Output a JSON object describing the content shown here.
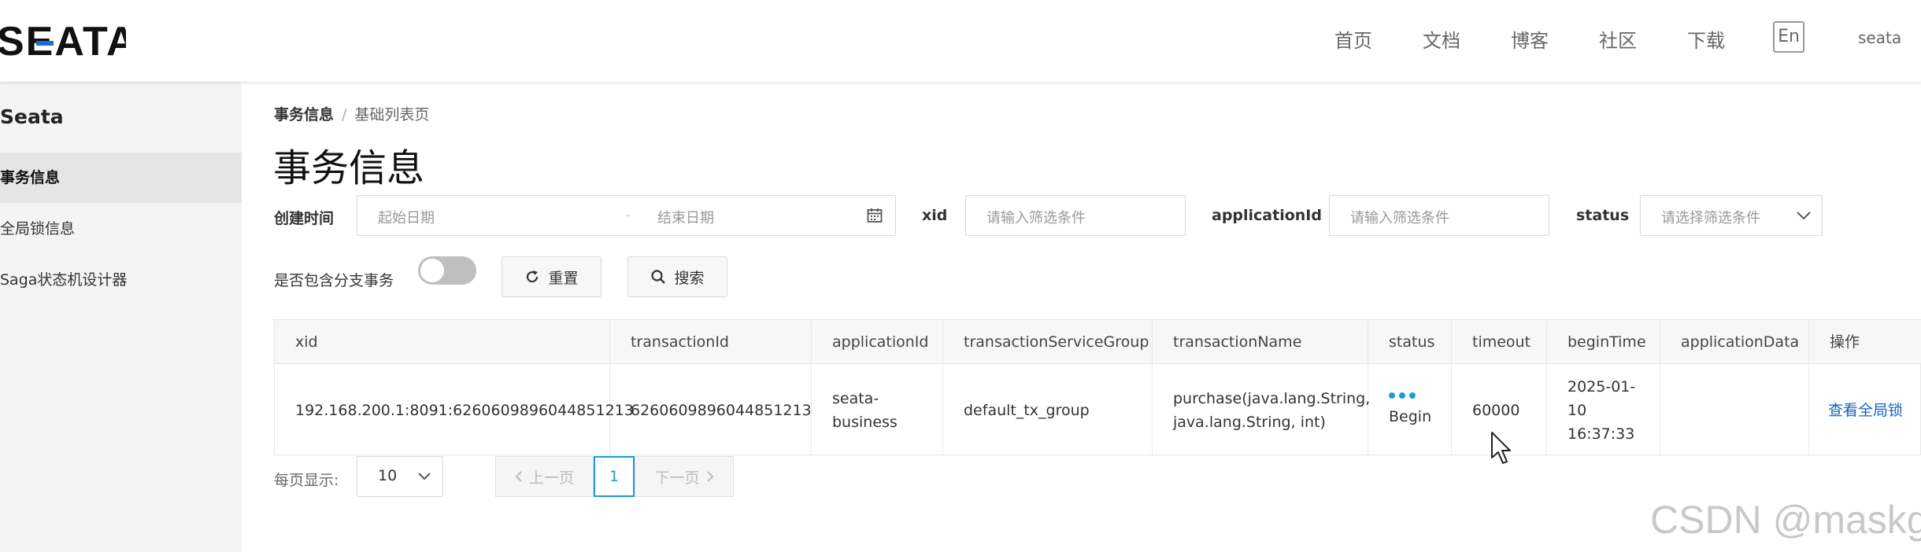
{
  "header": {
    "logo_text": "SEATA",
    "nav": [
      "首页",
      "文档",
      "博客",
      "社区",
      "下载"
    ],
    "lang": "En",
    "user": "seata"
  },
  "sidebar": {
    "title": "Seata",
    "items": [
      {
        "label": "事务信息",
        "active": true
      },
      {
        "label": "全局锁信息",
        "active": false
      },
      {
        "label": "Saga状态机设计器",
        "active": false
      }
    ]
  },
  "breadcrumb": {
    "first": "事务信息",
    "sep": "/",
    "second": "基础列表页"
  },
  "page_title": "事务信息",
  "filters": {
    "create_time_label": "创建时间",
    "start_placeholder": "起始日期",
    "range_sep": "-",
    "end_placeholder": "结束日期",
    "xid_label": "xid",
    "xid_placeholder": "请输入筛选条件",
    "app_label": "applicationId",
    "app_placeholder": "请输入筛选条件",
    "status_label": "status",
    "status_placeholder": "请选择筛选条件",
    "branch_label": "是否包含分支事务",
    "reset_label": "重置",
    "search_label": "搜索"
  },
  "table": {
    "columns": [
      "xid",
      "transactionId",
      "applicationId",
      "transactionServiceGroup",
      "transactionName",
      "status",
      "timeout",
      "beginTime",
      "applicationData",
      "操作"
    ],
    "row": {
      "xid": "192.168.200.1:8091:6260609896044851213",
      "transactionId": "6260609896044851213",
      "applicationId_1": "seata-",
      "applicationId_2": "business",
      "transactionServiceGroup": "default_tx_group",
      "transactionName_1": "purchase(java.lang.String,",
      "transactionName_2": "java.lang.String, int)",
      "status": "Begin",
      "timeout": "60000",
      "beginTime_1": "2025-01-",
      "beginTime_2": "10",
      "beginTime_3": "16:37:33",
      "applicationData": "",
      "action": "查看全局锁"
    }
  },
  "pagination": {
    "label": "每页显示:",
    "page_size": "10",
    "prev": "上一页",
    "current": "1",
    "next": "下一页"
  },
  "watermark": "CSDN @maskge",
  "colors": {
    "accent": "#1a9bdc",
    "link": "#1565c0"
  }
}
